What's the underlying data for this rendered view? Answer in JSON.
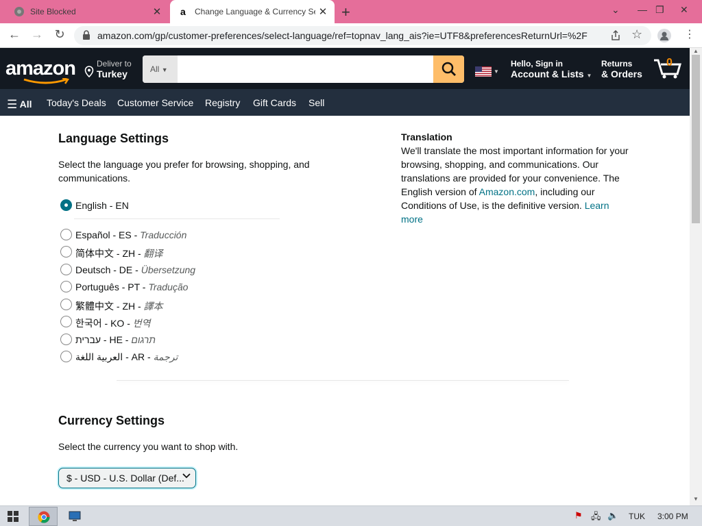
{
  "browser": {
    "tabs": [
      {
        "title": "Site Blocked",
        "active": false
      },
      {
        "title": "Change Language & Currency Se",
        "active": true
      }
    ],
    "url": "amazon.com/gp/customer-preferences/select-language/ref=topnav_lang_ais?ie=UTF8&preferencesReturnUrl=%2F"
  },
  "header": {
    "logo": "amazon",
    "deliver_line1": "Deliver to",
    "deliver_line2": "Turkey",
    "search_category": "All",
    "search_placeholder": "",
    "account_line1": "Hello, Sign in",
    "account_line2": "Account & Lists",
    "returns_line1": "Returns",
    "returns_line2": "& Orders",
    "cart_count": "0"
  },
  "nav": {
    "all_label": "All",
    "items": [
      "Today's Deals",
      "Customer Service",
      "Registry",
      "Gift Cards",
      "Sell"
    ]
  },
  "language": {
    "title": "Language Settings",
    "description": "Select the language you prefer for browsing, shopping, and communications.",
    "options": [
      {
        "name": "English - EN",
        "translation": "",
        "checked": true
      },
      {
        "name": "Español - ES - ",
        "translation": "Traducción",
        "checked": false
      },
      {
        "name": "简体中文 - ZH - ",
        "translation": "翻译",
        "checked": false
      },
      {
        "name": "Deutsch - DE - ",
        "translation": "Übersetzung",
        "checked": false
      },
      {
        "name": "Português - PT - ",
        "translation": "Tradução",
        "checked": false
      },
      {
        "name": "繁體中文 - ZH - ",
        "translation": "譯本",
        "checked": false
      },
      {
        "name": "한국어 - KO - ",
        "translation": "번역",
        "checked": false
      },
      {
        "name": "עברית - HE - ",
        "translation": "תרגום",
        "checked": false
      },
      {
        "name": "العربية اللغة - AR - ",
        "translation": "ترجمة",
        "checked": false
      }
    ]
  },
  "translation": {
    "title": "Translation",
    "text_before": "We'll translate the most important information for your browsing, shopping, and communications. Our translations are provided for your convenience. The English version of ",
    "link1": "Amazon.com",
    "text_after": ", including our Conditions of Use, is the definitive version. ",
    "link2": "Learn more"
  },
  "currency": {
    "title": "Currency Settings",
    "description": "Select the currency you want to shop with.",
    "selected": "$ - USD - U.S. Dollar (Def..."
  },
  "taskbar": {
    "lang": "TUK",
    "time": "3:00 PM"
  },
  "colors": {
    "header_bg": "#131921",
    "nav_bg": "#232f3e",
    "search_button": "#febd69",
    "link": "#007185",
    "titlebar": "#e56e9a"
  }
}
